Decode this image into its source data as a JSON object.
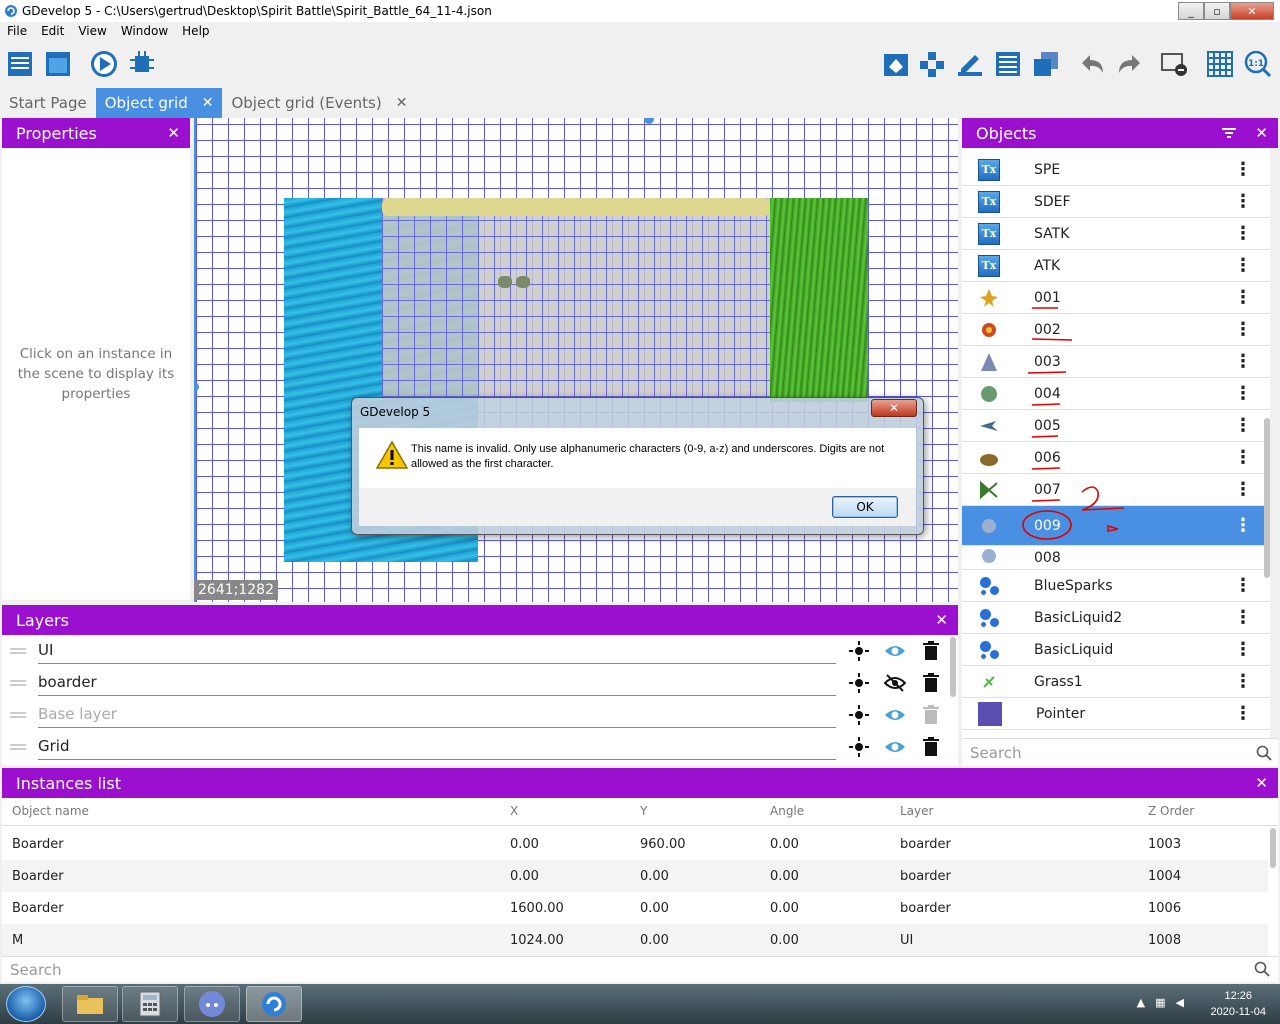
{
  "window": {
    "title": "GDevelop 5 - C:\\Users\\gertrud\\Desktop\\Spirit Battle\\Spirit_Battle_64_11-4.json",
    "minimize": "_",
    "maximize": "▫",
    "close": "✕"
  },
  "menu": [
    "File",
    "Edit",
    "View",
    "Window",
    "Help"
  ],
  "tabs": [
    {
      "label": "Start Page"
    },
    {
      "label": "Object grid",
      "close": "✕"
    },
    {
      "label": "Object grid (Events)",
      "close": "✕"
    }
  ],
  "properties": {
    "title": "Properties",
    "close": "✕",
    "empty_text": "Click on an instance in the scene to display its properties"
  },
  "scene": {
    "coords": "2641;1282"
  },
  "dialog": {
    "title": "GDevelop 5",
    "close": "✕",
    "message": "This name is invalid. Only use alphanumeric characters (0-9, a-z) and underscores. Digits are not allowed as the first character.",
    "ok": "OK"
  },
  "objects": {
    "title": "Objects",
    "close": "✕",
    "items": [
      {
        "name": "SPE",
        "icon": "text-object-icon"
      },
      {
        "name": "SDEF",
        "icon": "text-object-icon"
      },
      {
        "name": "SATK",
        "icon": "text-object-icon"
      },
      {
        "name": "ATK",
        "icon": "text-object-icon"
      },
      {
        "name": "001",
        "icon": "sprite-icon"
      },
      {
        "name": "002",
        "icon": "sprite-icon"
      },
      {
        "name": "003",
        "icon": "sprite-icon"
      },
      {
        "name": "004",
        "icon": "sprite-icon"
      },
      {
        "name": "005",
        "icon": "sprite-icon"
      },
      {
        "name": "006",
        "icon": "sprite-icon"
      },
      {
        "name": "007",
        "icon": "sprite-icon"
      },
      {
        "name": "009",
        "icon": "sprite-icon"
      },
      {
        "name": "008",
        "icon": "sprite-icon"
      },
      {
        "name": "BlueSparks",
        "icon": "particle-emitter-icon"
      },
      {
        "name": "BasicLiquid2",
        "icon": "particle-emitter-icon"
      },
      {
        "name": "BasicLiquid",
        "icon": "particle-emitter-icon"
      },
      {
        "name": "Grass1",
        "icon": "sprite-icon"
      },
      {
        "name": "Pointer",
        "icon": "sprite-icon"
      }
    ],
    "search_placeholder": "Search"
  },
  "layers": {
    "title": "Layers",
    "close": "✕",
    "items": [
      {
        "name": "UI",
        "visible": true
      },
      {
        "name": "boarder",
        "visible": false
      },
      {
        "name": "Base layer",
        "visible": true
      },
      {
        "name": "Grid",
        "visible": true
      }
    ]
  },
  "instances": {
    "title": "Instances list",
    "close": "✕",
    "columns": [
      "Object name",
      "X",
      "Y",
      "Angle",
      "Layer",
      "Z Order"
    ],
    "rows": [
      [
        "Boarder",
        "0.00",
        "960.00",
        "0.00",
        "boarder",
        "1003"
      ],
      [
        "Boarder",
        "0.00",
        "0.00",
        "0.00",
        "boarder",
        "1004"
      ],
      [
        "Boarder",
        "1600.00",
        "0.00",
        "0.00",
        "boarder",
        "1006"
      ],
      [
        "M",
        "1024.00",
        "0.00",
        "0.00",
        "UI",
        "1008"
      ]
    ],
    "search_placeholder": "Search"
  },
  "taskbar": {
    "time": "12:26",
    "date": "2020-11-04"
  },
  "colors": {
    "panel_header": "#9b0fce",
    "accent": "#4a90e2",
    "annotation": "#e00000"
  }
}
